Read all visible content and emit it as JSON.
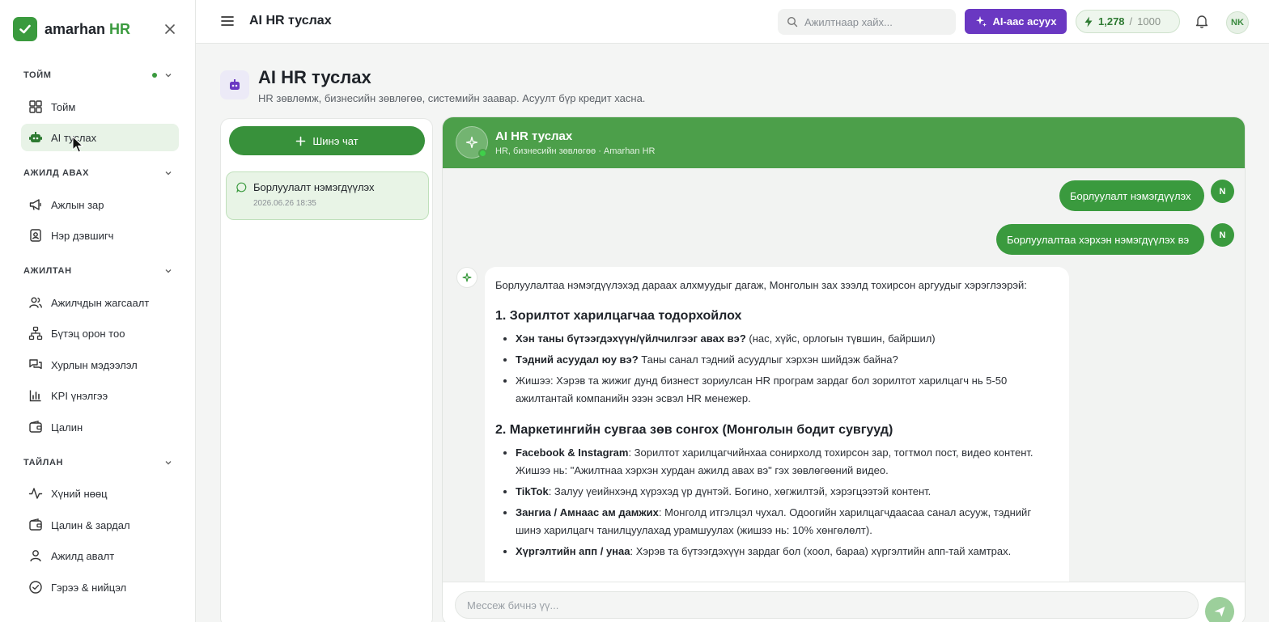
{
  "brand": {
    "name": "amarhan",
    "suffix": "HR"
  },
  "sidebar": {
    "sections": [
      {
        "label": "ТОЙМ",
        "items": [
          {
            "label": "Тойм"
          },
          {
            "label": "AI туслах"
          }
        ]
      },
      {
        "label": "АЖИЛД АВАХ",
        "items": [
          {
            "label": "Ажлын зар"
          },
          {
            "label": "Нэр дэвшигч"
          }
        ]
      },
      {
        "label": "АЖИЛТАН",
        "items": [
          {
            "label": "Ажилчдын жагсаалт"
          },
          {
            "label": "Бүтэц орон тоо"
          },
          {
            "label": "Хурлын мэдээлэл"
          },
          {
            "label": "KPI үнэлгээ"
          },
          {
            "label": "Цалин"
          }
        ]
      },
      {
        "label": "ТАЙЛАН",
        "items": [
          {
            "label": "Хүний нөөц"
          },
          {
            "label": "Цалин & зардал"
          },
          {
            "label": "Ажилд авалт"
          },
          {
            "label": "Гэрээ & нийцэл"
          }
        ]
      }
    ]
  },
  "topbar": {
    "title": "AI HR туслах",
    "search_placeholder": "Ажилтнаар хайх...",
    "ask_ai_label": "AI-аас асуух",
    "credits_current": "1,278",
    "credits_sep": "/",
    "credits_max": "1000",
    "avatar_initials": "NK"
  },
  "page": {
    "title": "AI HR туслах",
    "subtitle": "HR зөвлөмж, бизнесийн зөвлөгөө, системийн заавар. Асуулт бүр кредит хасна."
  },
  "chat_list": {
    "new_chat_label": "Шинэ чат",
    "items": [
      {
        "title": "Борлуулалт нэмэгдүүлэх",
        "time": "2026.06.26 18:35"
      }
    ]
  },
  "chat": {
    "header_title": "AI HR туслах",
    "header_sub": "HR, бизнесийн зөвлөгөө · Amarhan HR",
    "user_messages": [
      {
        "text": "Борлуулалт нэмэгдүүлэх",
        "initial": "N"
      },
      {
        "text": "Борлуулалтаа хэрхэн нэмэгдүүлэх вэ",
        "initial": "N"
      }
    ],
    "bot": {
      "intro": "Борлуулалтаа нэмэгдүүлэхэд дараах алхмуудыг дагаж, Монголын зах зээлд тохирсон аргуудыг хэрэглээрэй:",
      "h1": "1. Зорилтот харилцагчаа тодорхойлох",
      "s1": [
        {
          "bold": "Хэн таны бүтээгдэхүүн/үйлчилгээг авах вэ?",
          "text": " (нас, хүйс, орлогын түвшин, байршил)"
        },
        {
          "bold": "Тэдний асуудал юу вэ?",
          "text": " Таны санал тэдний асуудлыг хэрхэн шийдэж байна?"
        },
        {
          "bold": "",
          "text": "Жишээ: Хэрэв та жижиг дунд бизнест зориулсан HR програм зардаг бол зорилтот харилцагч нь 5-50 ажилтантай компанийн эзэн эсвэл HR менежер."
        }
      ],
      "h2": "2. Маркетингийн сувгаа зөв сонгох (Монголын бодит сувгууд)",
      "s2": [
        {
          "bold": "Facebook & Instagram",
          "text": ": Зорилтот харилцагчийнхаа сонирхолд тохирсон зар, тогтмол пост, видео контент. Жишээ нь: \"Ажилтнаа хэрхэн хурдан ажилд авах вэ\" гэх зөвлөгөөний видео."
        },
        {
          "bold": "TikTok",
          "text": ": Залуу үеийнхэнд хүрэхэд үр дүнтэй. Богино, хөгжилтэй, хэрэгцээтэй контент."
        },
        {
          "bold": "Зангиа / Амнаас ам дамжих",
          "text": ": Монголд итгэлцэл чухал. Одоогийн харилцагчдаасаа санал асууж, тэднийг шинэ харилцагч танилцуулахад урамшуулах (жишээ нь: 10% хөнгөлөлт)."
        },
        {
          "bold": "Хүргэлтийн апп / унаа",
          "text": ": Хэрэв та бүтээгдэхүүн зардаг бол (хоол, бараа) хүргэлтийн апп-тай хамтрах."
        }
      ]
    },
    "input_placeholder": "Мессеж бичнэ үү..."
  }
}
